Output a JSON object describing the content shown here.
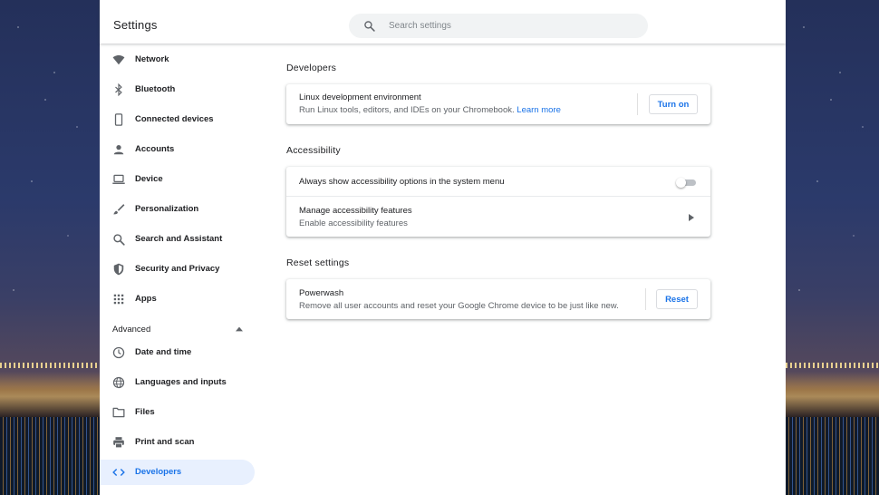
{
  "app": {
    "title": "Settings"
  },
  "search": {
    "placeholder": "Search settings",
    "icon": "search-icon"
  },
  "sidebar": {
    "items": [
      {
        "label": "Network",
        "icon": "wifi-icon"
      },
      {
        "label": "Bluetooth",
        "icon": "bluetooth-icon"
      },
      {
        "label": "Connected devices",
        "icon": "phone-icon"
      },
      {
        "label": "Accounts",
        "icon": "person-icon"
      },
      {
        "label": "Device",
        "icon": "laptop-icon"
      },
      {
        "label": "Personalization",
        "icon": "brush-icon"
      },
      {
        "label": "Search and Assistant",
        "icon": "search-icon"
      },
      {
        "label": "Security and Privacy",
        "icon": "shield-icon"
      },
      {
        "label": "Apps",
        "icon": "apps-grid-icon"
      }
    ],
    "advanced": {
      "label": "Advanced",
      "expanded": true
    },
    "advanced_items": [
      {
        "label": "Date and time",
        "icon": "clock-icon"
      },
      {
        "label": "Languages and inputs",
        "icon": "globe-icon"
      },
      {
        "label": "Files",
        "icon": "folder-icon"
      },
      {
        "label": "Print and scan",
        "icon": "printer-icon"
      },
      {
        "label": "Developers",
        "icon": "code-icon",
        "active": true
      }
    ]
  },
  "main": {
    "developers": {
      "title": "Developers",
      "linux": {
        "title": "Linux development environment",
        "subtitle": "Run Linux tools, editors, and IDEs on your Chromebook.",
        "link": "Learn more",
        "button": "Turn on"
      }
    },
    "accessibility": {
      "title": "Accessibility",
      "always_show": {
        "label": "Always show accessibility options in the system menu",
        "enabled": false
      },
      "manage": {
        "title": "Manage accessibility features",
        "subtitle": "Enable accessibility features"
      }
    },
    "reset": {
      "title": "Reset settings",
      "powerwash": {
        "title": "Powerwash",
        "subtitle": "Remove all user accounts and reset your Google Chrome device to be just like new.",
        "button": "Reset"
      }
    }
  },
  "colors": {
    "accent": "#1a73e8",
    "active_bg": "#e8f0fe",
    "icon": "#5f6368",
    "text": "#202124",
    "secondary_text": "#5f6368"
  }
}
